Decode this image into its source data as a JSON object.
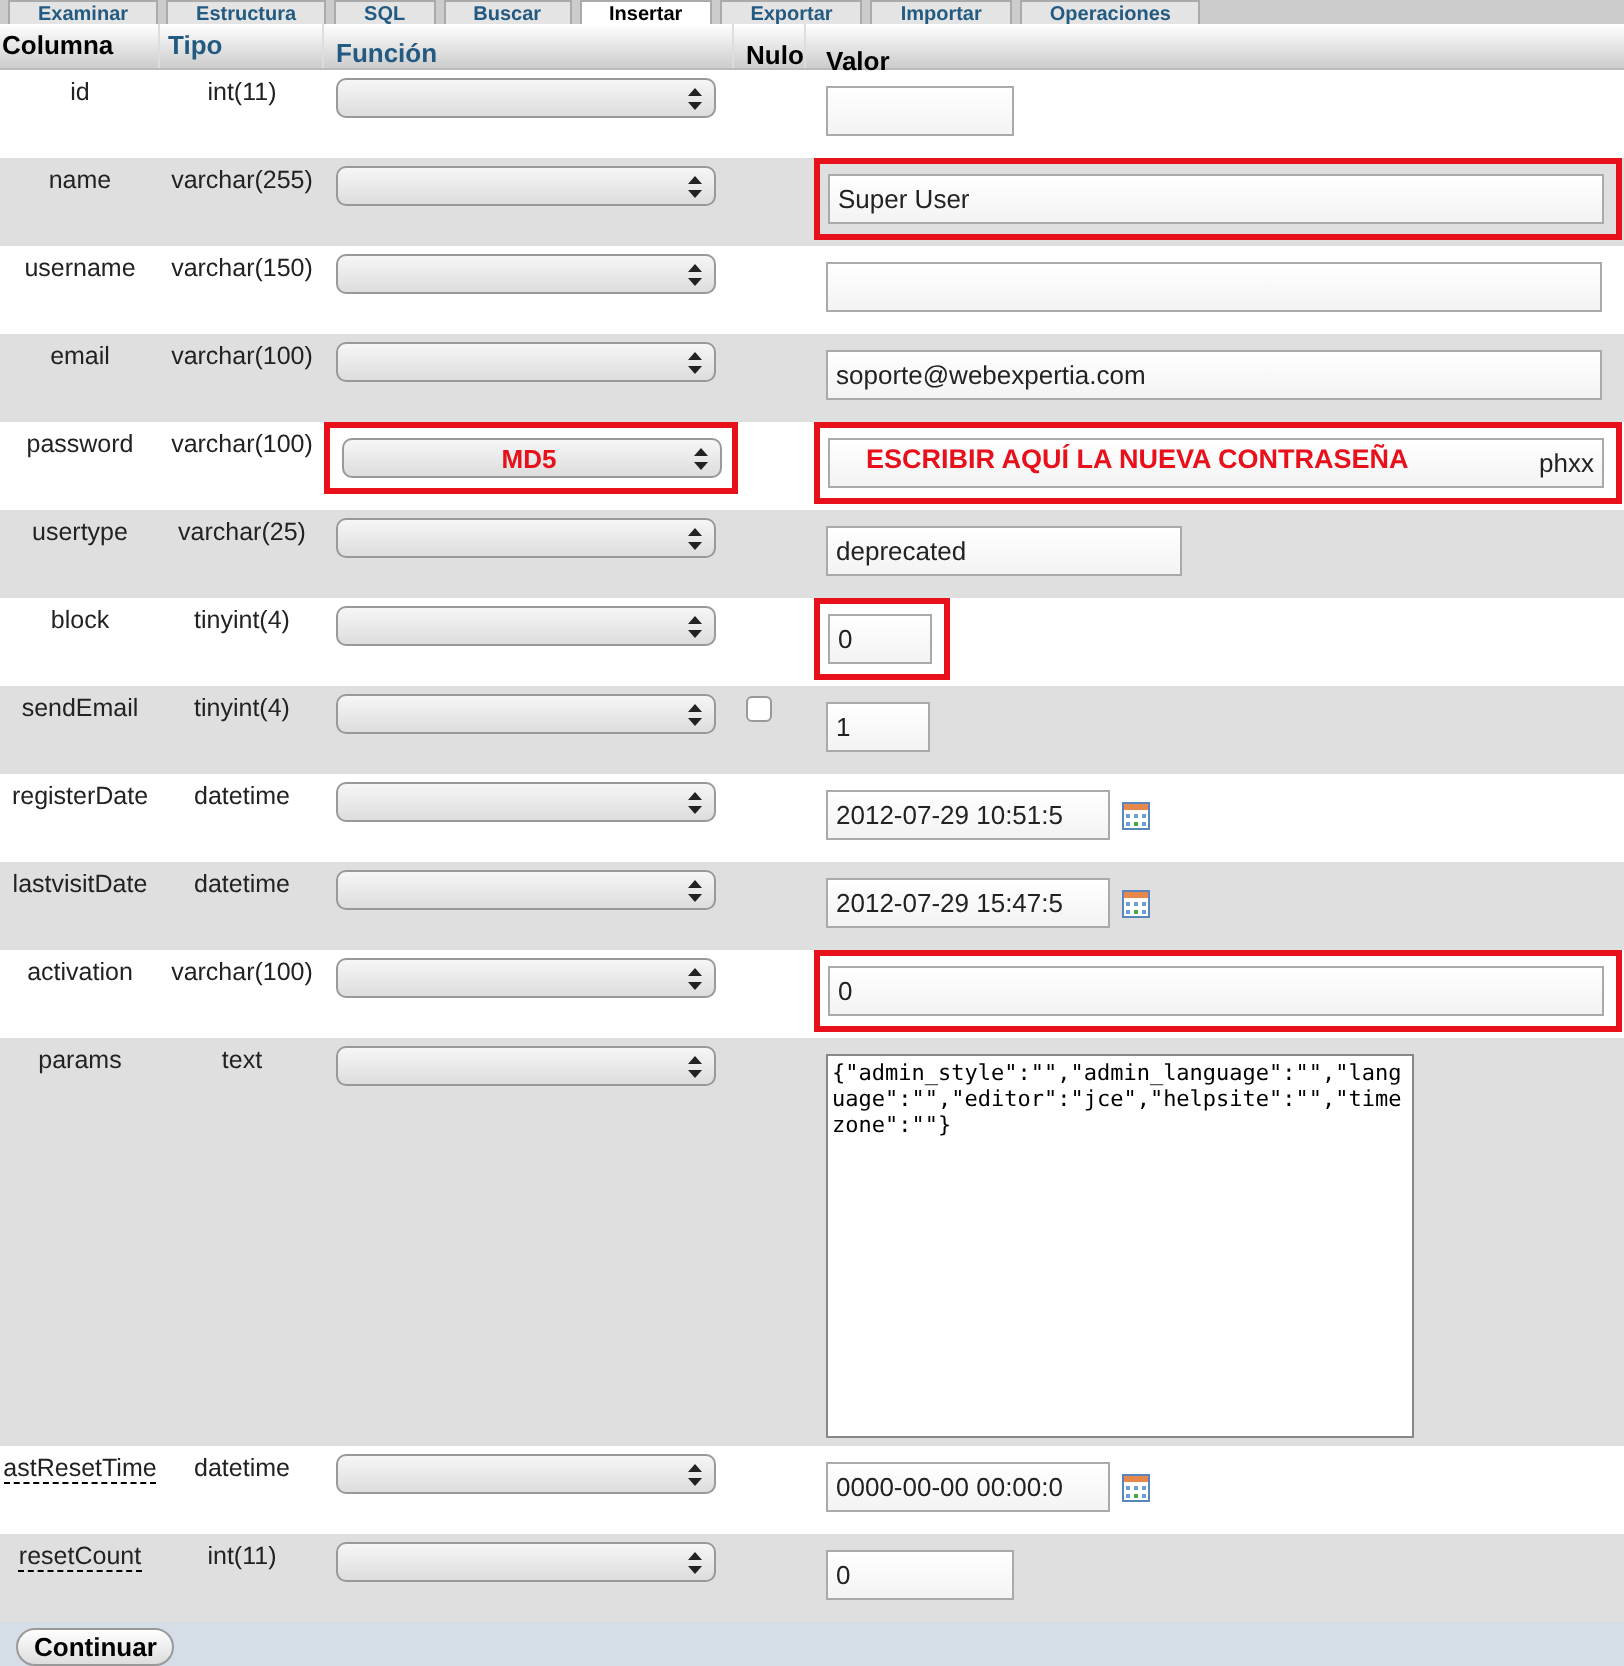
{
  "tabs": [
    {
      "label": "Examinar",
      "selected": false
    },
    {
      "label": "Estructura",
      "selected": false
    },
    {
      "label": "SQL",
      "selected": false
    },
    {
      "label": "Buscar",
      "selected": false
    },
    {
      "label": "Insertar",
      "selected": true
    },
    {
      "label": "Exportar",
      "selected": false
    },
    {
      "label": "Importar",
      "selected": false
    },
    {
      "label": "Operaciones",
      "selected": false
    }
  ],
  "table": {
    "columns": [
      "Columna",
      "Tipo",
      "Función",
      "Nulo",
      "Valor"
    ],
    "rows": [
      {
        "column": "id",
        "type": "int(11)",
        "function": "",
        "value": "",
        "kind": "medium",
        "has_comment": false,
        "function_highlighted": false,
        "value_highlighted": false
      },
      {
        "column": "name",
        "type": "varchar(255)",
        "function": "",
        "value": "Super User",
        "kind": "long",
        "has_comment": false,
        "function_highlighted": false,
        "value_highlighted": true
      },
      {
        "column": "username",
        "type": "varchar(150)",
        "function": "",
        "value": "",
        "kind": "long",
        "has_comment": false,
        "function_highlighted": false,
        "value_highlighted": false
      },
      {
        "column": "email",
        "type": "varchar(100)",
        "function": "",
        "value": "soporte@webexpertia.com",
        "kind": "long",
        "has_comment": false,
        "function_highlighted": false,
        "value_highlighted": false
      },
      {
        "column": "password",
        "type": "varchar(100)",
        "function": "MD5",
        "value": "phxx",
        "annotation": "ESCRIBIR AQUÍ LA NUEVA CONTRASEÑA",
        "kind": "long",
        "has_comment": false,
        "function_highlighted": true,
        "value_highlighted": true
      },
      {
        "column": "usertype",
        "type": "varchar(25)",
        "function": "",
        "value": "deprecated",
        "kind": "wide",
        "has_comment": false,
        "function_highlighted": false,
        "value_highlighted": false
      },
      {
        "column": "block",
        "type": "tinyint(4)",
        "function": "",
        "value": "0",
        "kind": "tiny",
        "has_comment": false,
        "function_highlighted": false,
        "value_highlighted": true
      },
      {
        "column": "sendEmail",
        "type": "tinyint(4)",
        "function": "",
        "value": "1",
        "kind": "tiny",
        "has_comment": false,
        "function_highlighted": false,
        "value_highlighted": false,
        "null_checked": false
      },
      {
        "column": "registerDate",
        "type": "datetime",
        "function": "",
        "value": "2012-07-29 10:51:5",
        "kind": "date",
        "has_comment": false,
        "function_highlighted": false,
        "value_highlighted": false
      },
      {
        "column": "lastvisitDate",
        "type": "datetime",
        "function": "",
        "value": "2012-07-29 15:47:5",
        "kind": "date",
        "has_comment": false,
        "function_highlighted": false,
        "value_highlighted": false
      },
      {
        "column": "activation",
        "type": "varchar(100)",
        "function": "",
        "value": "0",
        "kind": "long",
        "has_comment": false,
        "function_highlighted": false,
        "value_highlighted": true
      },
      {
        "column": "params",
        "type": "text",
        "function": "",
        "value": "{\"admin_style\":\"\",\"admin_language\":\"\",\"language\":\"\",\"editor\":\"jce\",\"helpsite\":\"\",\"timezone\":\"\"}",
        "kind": "textarea",
        "has_comment": false,
        "function_highlighted": false,
        "value_highlighted": false
      },
      {
        "column": "astResetTime",
        "type": "datetime",
        "function": "",
        "value": "0000-00-00 00:00:0",
        "kind": "date",
        "has_comment": true,
        "function_highlighted": false,
        "value_highlighted": false
      },
      {
        "column": "resetCount",
        "type": "int(11)",
        "function": "",
        "value": "0",
        "kind": "medium",
        "has_comment": true,
        "function_highlighted": false,
        "value_highlighted": false
      }
    ]
  },
  "submit_button": "Continuar"
}
